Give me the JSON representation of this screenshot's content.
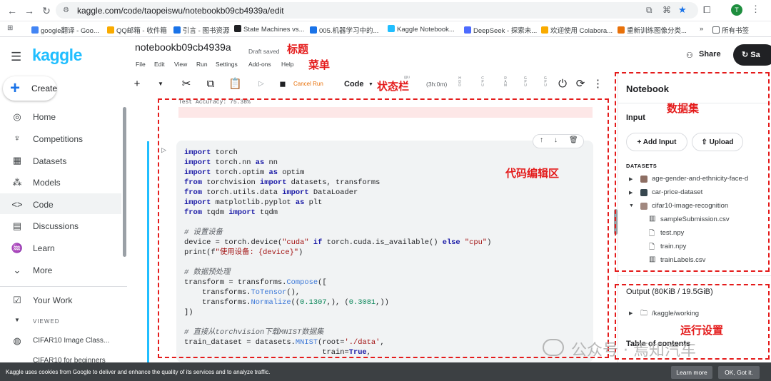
{
  "browser": {
    "url": "kaggle.com/code/taopeiswu/notebookb09cb4939a/edit",
    "bookmarks": [
      "google翻译 - Goo...",
      "QQ邮箱 - 收件箱",
      "引言 - 图书资源",
      "State Machines vs...",
      "005.机器学习中的...",
      "Kaggle Notebook...",
      "DeepSeek - 探索未...",
      "欢迎使用 Colabora...",
      "重新训练图像分类...",
      "所有书签"
    ],
    "profile_initial": "T"
  },
  "kaggle": {
    "logo": "kaggle",
    "create_label": "Create",
    "nav": [
      {
        "label": "Home",
        "icon": "home-icon"
      },
      {
        "label": "Competitions",
        "icon": "trophy-icon"
      },
      {
        "label": "Datasets",
        "icon": "table-icon"
      },
      {
        "label": "Models",
        "icon": "models-icon"
      },
      {
        "label": "Code",
        "icon": "code-icon"
      },
      {
        "label": "Discussions",
        "icon": "comment-icon"
      },
      {
        "label": "Learn",
        "icon": "learn-icon"
      },
      {
        "label": "More",
        "icon": "chevron-down-icon"
      }
    ],
    "your_work": "Your Work",
    "viewed_label": "VIEWED",
    "viewed_items": [
      "CIFAR10 Image Class...",
      "CIFAR10 for beginners"
    ]
  },
  "notebook": {
    "title": "notebookb09cb4939a",
    "draft_status": "Draft saved",
    "menus": [
      "File",
      "Edit",
      "View",
      "Run",
      "Settings",
      "Add-ons",
      "Help"
    ],
    "share_label": "Share",
    "save_label": "Sa",
    "cancel_run": "Cancel Run",
    "cell_type": "Code",
    "session_time": "(3h:0m)",
    "prev_output": "Test Accuracy: 75.38%",
    "code_lines": [
      "import torch",
      "import torch.nn as nn",
      "import torch.optim as optim",
      "from torchvision import datasets, transforms",
      "from torch.utils.data import DataLoader",
      "import matplotlib.pyplot as plt",
      "from tqdm import tqdm",
      "",
      "# 设置设备",
      "device = torch.device(\"cuda\" if torch.cuda.is_available() else \"cpu\")",
      "print(f\"使用设备: {device}\")",
      "",
      "# 数据预处理",
      "transform = transforms.Compose([",
      "    transforms.ToTensor(),",
      "    transforms.Normalize((0.1307,), (0.3081,))",
      "])",
      "",
      "# 直接从torchvision下载MNIST数据集",
      "train_dataset = datasets.MNIST(root='./data',",
      "                               train=True,"
    ]
  },
  "panel": {
    "title": "Notebook",
    "input_label": "Input",
    "add_input": "Add Input",
    "upload": "Upload",
    "datasets_header": "DATASETS",
    "datasets": [
      {
        "name": "age-gender-and-ethnicity-face-d",
        "expanded": false
      },
      {
        "name": "car-price-dataset",
        "expanded": false
      },
      {
        "name": "cifar10-image-recognition",
        "expanded": true
      }
    ],
    "files": [
      {
        "name": "sampleSubmission.csv",
        "icon": "table-file-icon"
      },
      {
        "name": "test.npy",
        "icon": "file-icon"
      },
      {
        "name": "train.npy",
        "icon": "file-icon"
      },
      {
        "name": "trainLabels.csv",
        "icon": "table-file-icon"
      }
    ],
    "output_label": "Output (80KiB / 19.5GiB)",
    "output_path": "/kaggle/working",
    "toc_label": "Table of contents"
  },
  "annotations": {
    "title": "标题",
    "menu": "菜单",
    "status_bar": "状态栏",
    "dataset": "数据集",
    "code_editor": "代码编辑区",
    "run_settings": "运行设置",
    "color": "#e41b1b"
  },
  "watermark": "公众号 · 焉知汽车",
  "cookie": {
    "text": "Kaggle uses cookies from Google to deliver and enhance the quality of its services and to analyze traffic.",
    "learn_more": "Learn more",
    "ok": "OK, Got it."
  }
}
